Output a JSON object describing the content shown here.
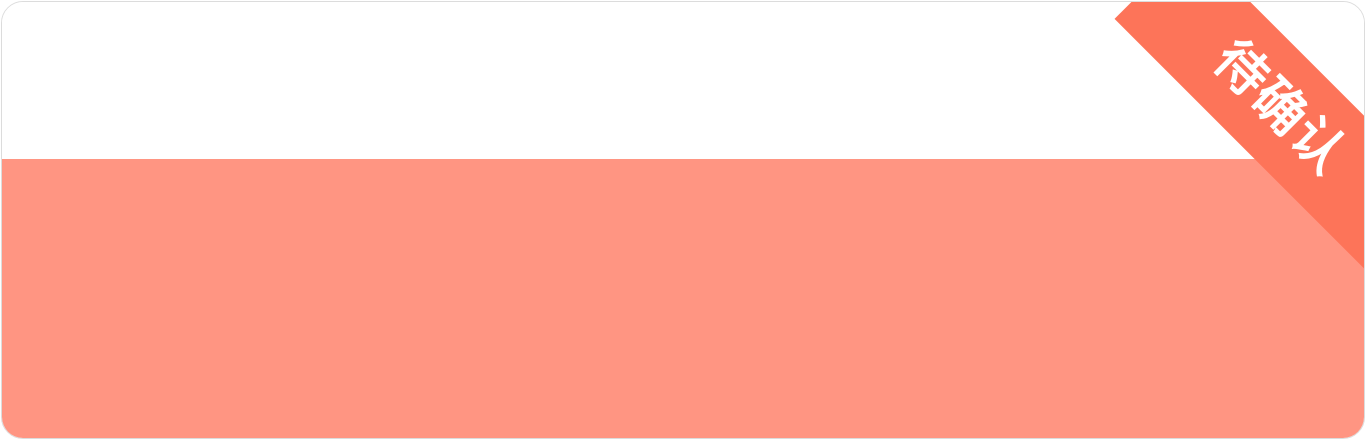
{
  "status_ribbon": {
    "label": "待确认"
  },
  "colors": {
    "ribbon": "#fd7459",
    "panel": "#ff9582",
    "border": "#dcdcdc"
  }
}
